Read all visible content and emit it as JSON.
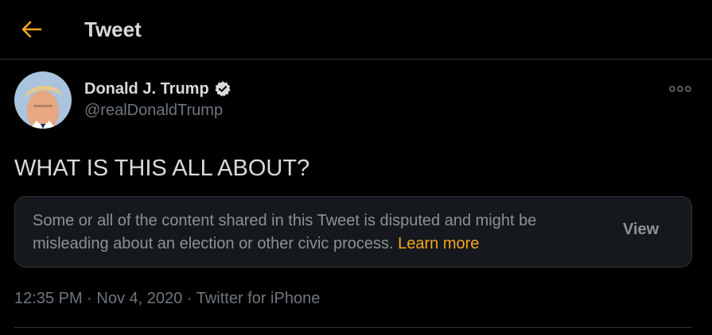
{
  "header": {
    "title": "Tweet",
    "back_icon": "arrow-left-icon",
    "accent_color": "#f5a623"
  },
  "tweet": {
    "author_name": "Donald J. Trump",
    "author_handle": "@realDonaldTrump",
    "verified": true,
    "text": "WHAT IS THIS ALL ABOUT?",
    "notice": {
      "text": "Some or all of the content shared in this Tweet is disputed and might be misleading about an election or other civic process.",
      "learn_more": "Learn more",
      "view_label": "View"
    },
    "meta": {
      "time": "12:35 PM",
      "separator": "·",
      "date": "Nov 4, 2020",
      "source": "Twitter for iPhone"
    }
  },
  "colors": {
    "background": "#000000",
    "text_primary": "#d9d9d9",
    "text_secondary": "#6e767d",
    "accent": "#f5a623",
    "notice_bg": "#15181c",
    "border": "#2f3336"
  }
}
